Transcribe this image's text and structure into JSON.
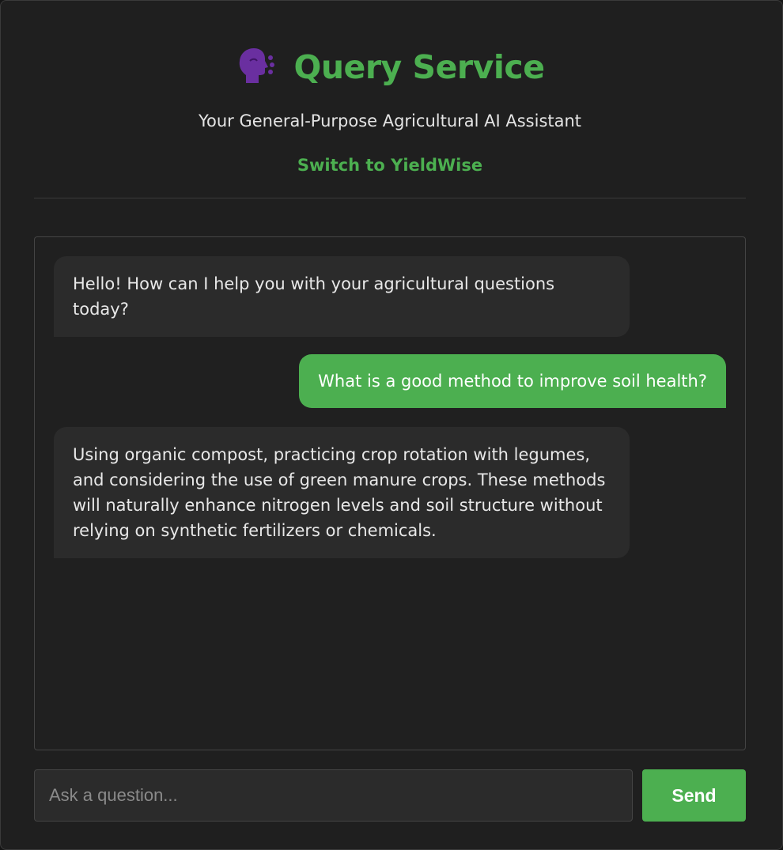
{
  "header": {
    "icon": "speaking-head-icon",
    "title": "Query Service",
    "subtitle": "Your General-Purpose Agricultural AI Assistant",
    "switch_link": "Switch to YieldWise"
  },
  "chat": {
    "messages": [
      {
        "role": "assistant",
        "text": "Hello! How can I help you with your agricultural questions today?"
      },
      {
        "role": "user",
        "text": "What is a good method to improve soil health?"
      },
      {
        "role": "assistant",
        "text": "Using organic compost, practicing crop rotation with legumes, and considering the use of green manure crops. These methods will naturally enhance nitrogen levels and soil structure without relying on synthetic fertilizers or chemicals."
      }
    ]
  },
  "input": {
    "placeholder": "Ask a question...",
    "value": ""
  },
  "send_button": {
    "label": "Send"
  },
  "colors": {
    "accent": "#4caf50",
    "background": "#1f1f1f",
    "bubble_bot": "#2b2b2b",
    "icon_purple": "#6a2fa0"
  }
}
